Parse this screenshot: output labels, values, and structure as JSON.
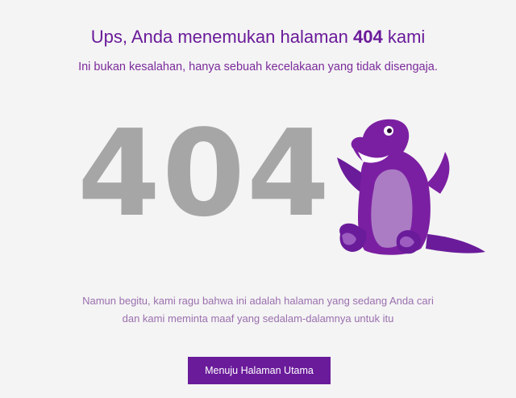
{
  "header": {
    "title_prefix": "Ups, Anda menemukan halaman ",
    "title_code": "404",
    "title_suffix": " kami",
    "subtitle": "Ini bukan kesalahan, hanya sebuah kecelakaan yang tidak disengaja."
  },
  "hero": {
    "error_code": "404",
    "mascot_icon": "purple-dinosaur-icon"
  },
  "message": {
    "line1": "Namun begitu, kami ragu bahwa ini adalah halaman yang sedang Anda cari",
    "line2": "dan kami meminta maaf yang sedalam-dalamnya untuk itu"
  },
  "actions": {
    "home_label": "Menuju Halaman Utama"
  },
  "colors": {
    "accent": "#6a1b9a",
    "background": "#f4f4f4",
    "error_code": "#a6a6a6",
    "dino_body": "#7b1fa2",
    "dino_belly": "#ab7cc4"
  }
}
